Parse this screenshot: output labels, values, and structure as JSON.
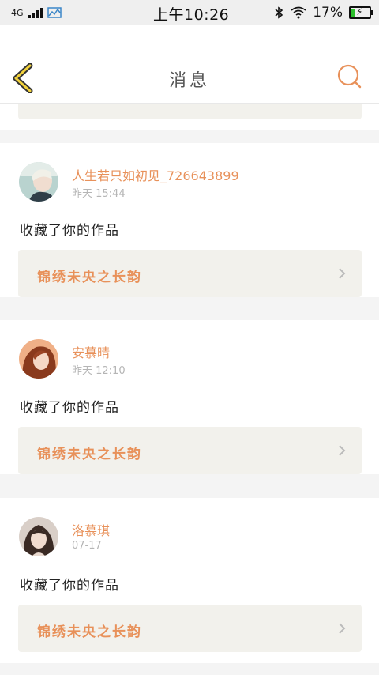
{
  "status_bar": {
    "network": "4G",
    "time": "上午10:26",
    "battery_percent": "17%",
    "battery_level": 0.17
  },
  "header": {
    "title": "消息",
    "icons": [
      "back-chevron-icon",
      "search-icon"
    ],
    "accent": "#e8915a"
  },
  "messages": [
    {
      "user": "人生若只如初见_726643899",
      "time": "昨天 15:44",
      "action": "收藏了你的作品",
      "work_title": "锦绣未央之长韵"
    },
    {
      "user": "安慕晴",
      "time": "昨天 12:10",
      "action": "收藏了你的作品",
      "work_title": "锦绣未央之长韵"
    },
    {
      "user": "洛慕琪",
      "time": "07-17",
      "action": "收藏了你的作品",
      "work_title": "锦绣未央之长韵"
    }
  ]
}
